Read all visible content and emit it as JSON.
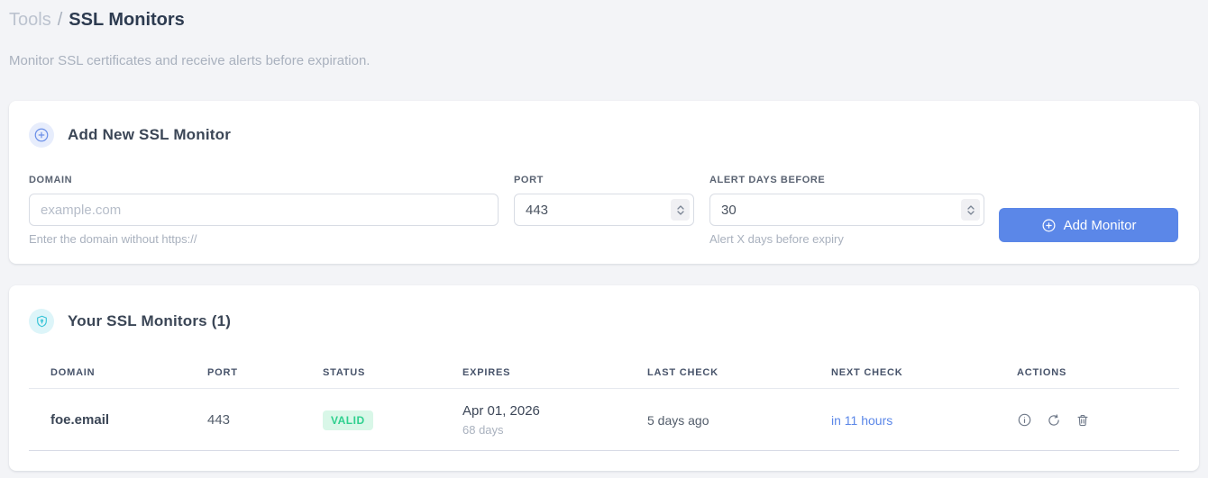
{
  "breadcrumb": {
    "section": "Tools",
    "separator": "/",
    "page": "SSL Monitors"
  },
  "subtitle": "Monitor SSL certificates and receive alerts before expiration.",
  "add_form": {
    "title": "Add New SSL Monitor",
    "fields": {
      "domain": {
        "label": "DOMAIN",
        "placeholder": "example.com",
        "helper": "Enter the domain without https://"
      },
      "port": {
        "label": "PORT",
        "value": "443"
      },
      "alert_days": {
        "label": "ALERT DAYS BEFORE",
        "value": "30",
        "helper": "Alert X days before expiry"
      }
    },
    "submit_label": "Add Monitor"
  },
  "monitors": {
    "title": "Your SSL Monitors (1)",
    "table": {
      "headers": [
        "DOMAIN",
        "PORT",
        "STATUS",
        "EXPIRES",
        "LAST CHECK",
        "NEXT CHECK",
        "ACTIONS"
      ],
      "rows": [
        {
          "domain": "foe.email",
          "port": "443",
          "status": "VALID",
          "expires_date": "Apr 01, 2026",
          "expires_days": "68 days",
          "last_check": "5 days ago",
          "next_check": "in 11 hours"
        }
      ]
    }
  },
  "icons": {
    "add_badge": "plus-circle-icon",
    "monitors_badge": "shield-lock-icon",
    "submit": "plus-circle-icon",
    "row_actions": [
      "info-icon",
      "refresh-icon",
      "trash-icon"
    ]
  },
  "colors": {
    "accent_blue": "#5b87e8",
    "badge_valid_bg": "#d9f7e8",
    "badge_valid_text": "#2fd08f",
    "shield_cyan": "#35c4d7",
    "page_bg": "#f3f4f7"
  }
}
